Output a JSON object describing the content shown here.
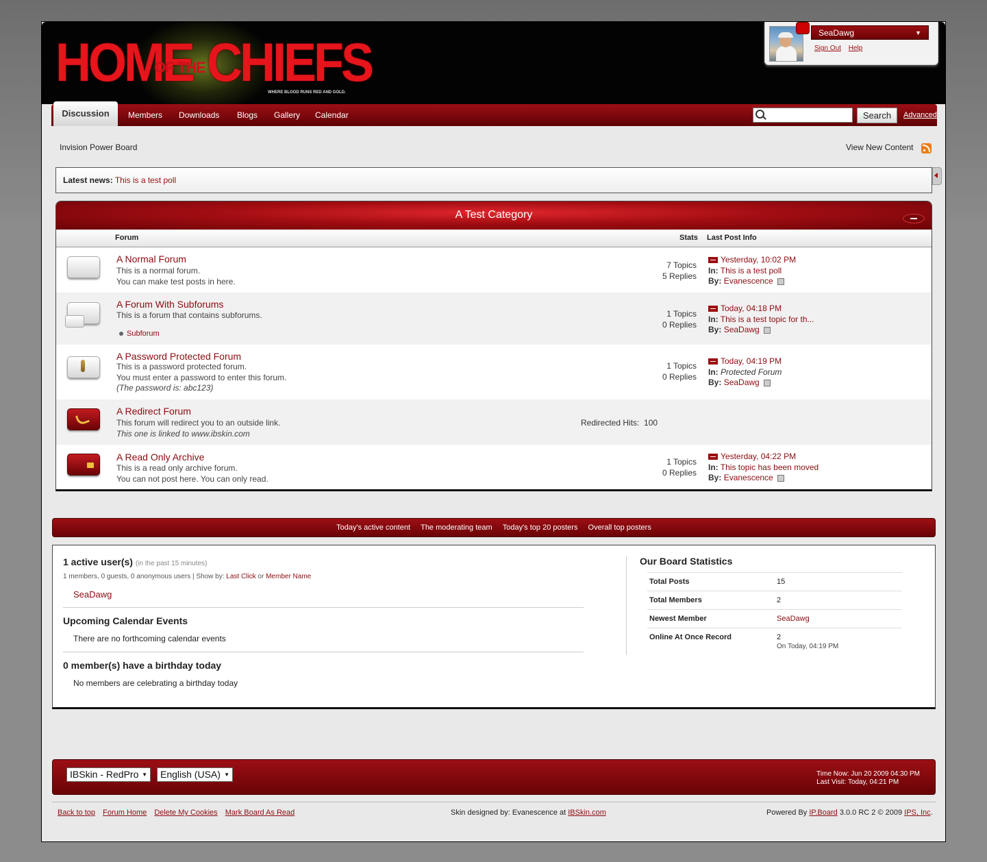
{
  "header": {
    "logo_home": "HOME",
    "logo_of_the": "OF THE",
    "logo_chiefs": "CHIEFS",
    "logo_tagline": "WHERE BLOOD RUNS RED AND GOLD."
  },
  "user": {
    "name": "SeaDawg",
    "sign_out": "Sign Out",
    "help": "Help"
  },
  "nav": {
    "tabs": [
      "Discussion",
      "Members",
      "Downloads",
      "Blogs",
      "Gallery",
      "Calendar"
    ],
    "search_button": "Search",
    "advanced": "Advanced"
  },
  "breadcrumb": "Invision Power Board",
  "view_new_content": "View New Content",
  "news": {
    "label": "Latest news:",
    "link": "This is a test poll"
  },
  "category": {
    "title": "A Test Category",
    "col_forum": "Forum",
    "col_stats": "Stats",
    "col_last": "Last Post Info",
    "forums": [
      {
        "name": "A Normal Forum",
        "desc1": "This is a normal forum.",
        "desc2": "You can make test posts in here.",
        "topics": "7 Topics",
        "replies": "5 Replies",
        "date": "Yesterday, 10:02 PM",
        "in_label": "In:",
        "in": "This is a test poll",
        "by_label": "By:",
        "by": "Evanescence"
      },
      {
        "name": "A Forum With Subforums",
        "desc1": "This is a forum that contains subforums.",
        "subforum": "Subforum",
        "topics": "1 Topics",
        "replies": "0 Replies",
        "date": "Today, 04:18 PM",
        "in_label": "In:",
        "in": "This is a test topic for th...",
        "by_label": "By:",
        "by": "SeaDawg"
      },
      {
        "name": "A Password Protected Forum",
        "desc1": "This is a password protected forum.",
        "desc2": "You must enter a password to enter this forum.",
        "desc3": "(The password is: abc123)",
        "topics": "1 Topics",
        "replies": "0 Replies",
        "date": "Today, 04:19 PM",
        "in_label": "In:",
        "in": "Protected Forum",
        "by_label": "By:",
        "by": "SeaDawg"
      },
      {
        "name": "A Redirect Forum",
        "desc1": "This forum will redirect you to an outside link.",
        "desc2": "This one is linked to www.ibskin.com",
        "hits_label": "Redirected Hits:",
        "hits": "100"
      },
      {
        "name": "A Read Only Archive",
        "desc1": "This is a read only archive forum.",
        "desc2": "You can not post here. You can only read.",
        "topics": "1 Topics",
        "replies": "0 Replies",
        "date": "Yesterday, 04:22 PM",
        "in_label": "In:",
        "in": "This topic has been moved",
        "by_label": "By:",
        "by": "Evanescence"
      }
    ]
  },
  "stats_bar": [
    "Today's active content",
    "The moderating team",
    "Today's top 20 posters",
    "Overall top posters"
  ],
  "board": {
    "active_title": "1 active user(s)",
    "active_sub": "(in the past 15 minutes)",
    "active_detail": "1 members, 0 guests, 0 anonymous users  |  Show by: ",
    "last_click": "Last Click",
    "or": " or ",
    "member_name": "Member Name",
    "active_user": "SeaDawg",
    "calendar_title": "Upcoming Calendar Events",
    "calendar_text": "There are no forthcoming calendar events",
    "birthday_title": "0 member(s) have a birthday today",
    "birthday_text": "No members are celebrating a birthday today",
    "stats_title": "Our Board Statistics",
    "stats": [
      {
        "k": "Total Posts",
        "v": "15"
      },
      {
        "k": "Total Members",
        "v": "2"
      },
      {
        "k": "Newest Member",
        "v": "SeaDawg"
      },
      {
        "k": "Online At Once Record",
        "v": "2",
        "v2": "On Today, 04:19 PM"
      }
    ]
  },
  "footer": {
    "skin": "IBSkin - RedPro",
    "language": "English (USA)",
    "time_now": "Time Now: Jun 20 2009 04:30 PM",
    "last_visit": "Last Visit: Today, 04:21 PM",
    "links": [
      "Back to top",
      "Forum Home",
      "Delete My Cookies",
      "Mark Board As Read"
    ],
    "designed_pre": "Skin designed by: Evanescence at ",
    "designed_link": "IBSkin.com",
    "powered_pre": "Powered By ",
    "powered_link": "IP.Board",
    "powered_mid": " 3.0.0 RC 2 © 2009  ",
    "powered_ips": "IPS, Inc",
    "powered_end": "."
  }
}
